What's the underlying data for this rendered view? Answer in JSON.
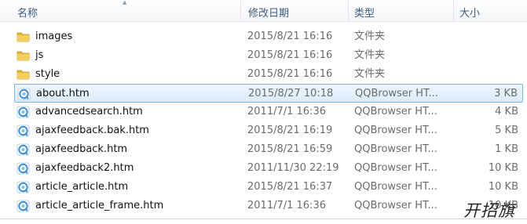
{
  "columns": {
    "name": "名称",
    "date": "修改日期",
    "type": "类型",
    "size": "大小"
  },
  "files": [
    {
      "name": "images",
      "date": "2015/8/21 16:16",
      "type": "文件夹",
      "size": "",
      "icon": "folder-icon"
    },
    {
      "name": "js",
      "date": "2015/8/21 16:16",
      "type": "文件夹",
      "size": "",
      "icon": "folder-icon"
    },
    {
      "name": "style",
      "date": "2015/8/21 16:16",
      "type": "文件夹",
      "size": "",
      "icon": "folder-icon"
    },
    {
      "name": "about.htm",
      "date": "2015/8/27 10:18",
      "type": "QQBrowser HT...",
      "size": "3 KB",
      "icon": "browser-file-icon",
      "selected": true
    },
    {
      "name": "advancedsearch.htm",
      "date": "2011/7/1 16:36",
      "type": "QQBrowser HT...",
      "size": "4 KB",
      "icon": "browser-file-icon"
    },
    {
      "name": "ajaxfeedback.bak.htm",
      "date": "2015/8/21 16:19",
      "type": "QQBrowser HT...",
      "size": "5 KB",
      "icon": "browser-file-icon"
    },
    {
      "name": "ajaxfeedback.htm",
      "date": "2015/8/21 16:59",
      "type": "QQBrowser HT...",
      "size": "1 KB",
      "icon": "browser-file-icon"
    },
    {
      "name": "ajaxfeedback2.htm",
      "date": "2011/11/30 22:19",
      "type": "QQBrowser HT...",
      "size": "10 KB",
      "icon": "browser-file-icon"
    },
    {
      "name": "article_article.htm",
      "date": "2015/8/21 16:37",
      "type": "QQBrowser HT...",
      "size": "10 KB",
      "icon": "browser-file-icon"
    },
    {
      "name": "article_article_frame.htm",
      "date": "2011/7/1 16:36",
      "type": "QQBrowser HT...",
      "size": "10 KB",
      "icon": "browser-file-icon"
    }
  ],
  "watermark": "开招旗",
  "colors": {
    "folder": "#e8b53a",
    "browser_icon": "#3d8fd6",
    "selection_border": "#7eb4ea"
  }
}
